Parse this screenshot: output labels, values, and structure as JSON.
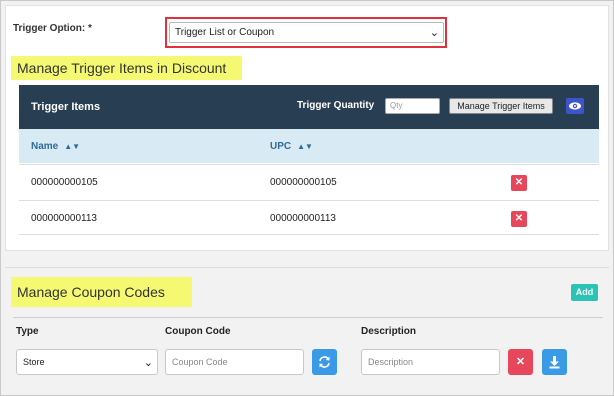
{
  "trigger_option": {
    "label": "Trigger Option: *",
    "selected": "Trigger List or Coupon"
  },
  "trigger_items_section": {
    "title": "Manage Trigger Items in Discount",
    "table_title": "Trigger Items",
    "quantity_label": "Trigger Quantity",
    "quantity_placeholder": "Qty",
    "manage_button": "Manage Trigger Items",
    "columns": [
      "Name",
      "UPC"
    ],
    "rows": [
      {
        "name": "000000000105",
        "upc": "000000000105"
      },
      {
        "name": "000000000113",
        "upc": "000000000113"
      }
    ]
  },
  "coupon_section": {
    "title": "Manage Coupon Codes",
    "add_button": "Add",
    "labels": {
      "type": "Type",
      "coupon_code": "Coupon Code",
      "description": "Description"
    },
    "type_selected": "Store",
    "coupon_placeholder": "Coupon Code",
    "description_placeholder": "Description"
  },
  "colors": {
    "header_bg": "#283e52",
    "highlight": "#f5f971",
    "danger": "#e6475a",
    "primary": "#3a9ae6",
    "teal": "#2bc4b4"
  }
}
